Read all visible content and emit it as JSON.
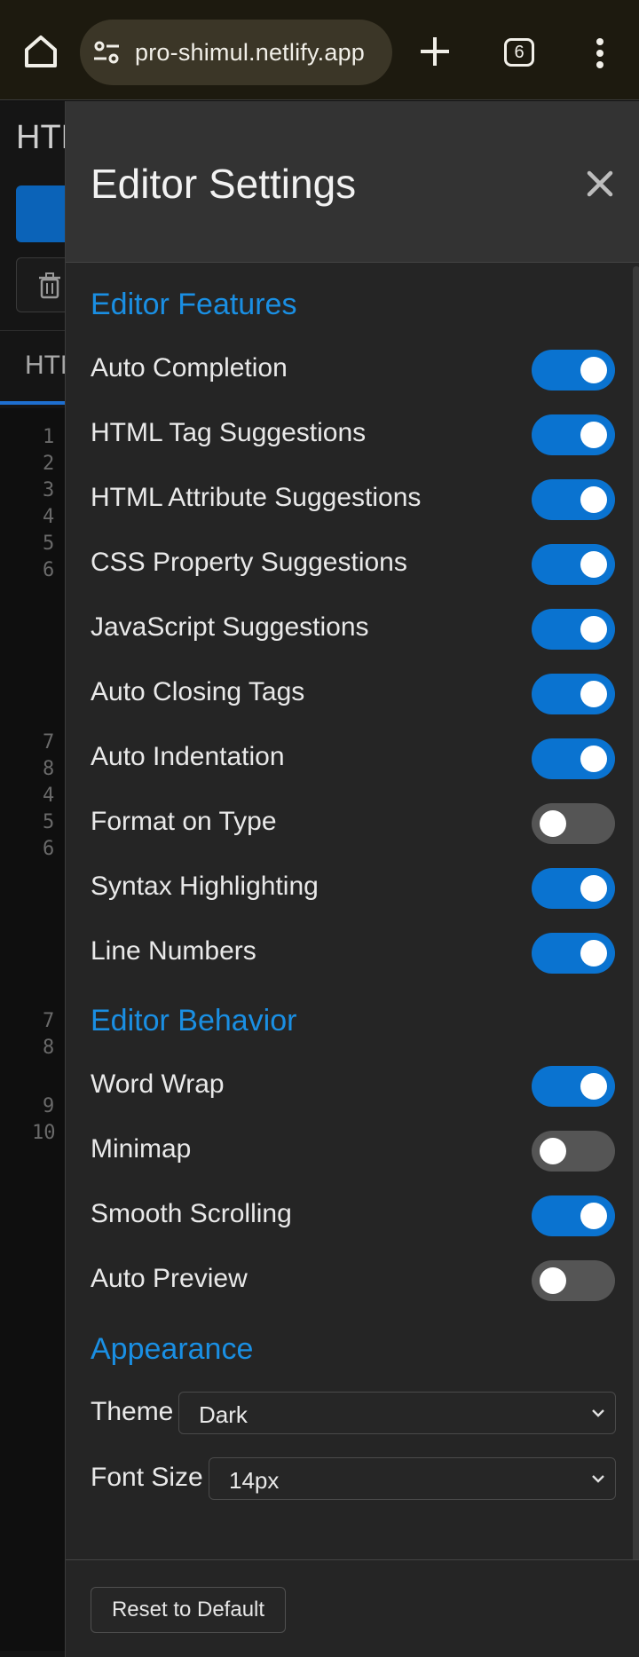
{
  "browser": {
    "url": "pro-shimul.netlify.app",
    "tab_count": "6"
  },
  "background_app": {
    "title": "HTM",
    "tab_label": "HTM",
    "line_numbers": [
      "1",
      "2",
      "3",
      "4",
      "5",
      "6",
      "7",
      "8",
      "4",
      "5",
      "6",
      "7",
      "8",
      "9",
      "10"
    ]
  },
  "settings": {
    "title": "Editor Settings",
    "sections": {
      "features": {
        "title": "Editor Features",
        "items": [
          {
            "label": "Auto Completion",
            "enabled": true
          },
          {
            "label": "HTML Tag Suggestions",
            "enabled": true
          },
          {
            "label": "HTML Attribute Suggestions",
            "enabled": true
          },
          {
            "label": "CSS Property Suggestions",
            "enabled": true
          },
          {
            "label": "JavaScript Suggestions",
            "enabled": true
          },
          {
            "label": "Auto Closing Tags",
            "enabled": true
          },
          {
            "label": "Auto Indentation",
            "enabled": true
          },
          {
            "label": "Format on Type",
            "enabled": false
          },
          {
            "label": "Syntax Highlighting",
            "enabled": true
          },
          {
            "label": "Line Numbers",
            "enabled": true
          }
        ]
      },
      "behavior": {
        "title": "Editor Behavior",
        "items": [
          {
            "label": "Word Wrap",
            "enabled": true
          },
          {
            "label": "Minimap",
            "enabled": false
          },
          {
            "label": "Smooth Scrolling",
            "enabled": true
          },
          {
            "label": "Auto Preview",
            "enabled": false
          }
        ]
      },
      "appearance": {
        "title": "Appearance",
        "theme_label": "Theme",
        "theme_value": "Dark",
        "font_size_label": "Font Size",
        "font_size_value": "14px"
      }
    },
    "reset_label": "Reset to Default"
  },
  "colors": {
    "accent": "#1a8fe3",
    "toggle_on": "#0a73d0",
    "toggle_off": "#555555",
    "panel_bg": "#252525"
  }
}
